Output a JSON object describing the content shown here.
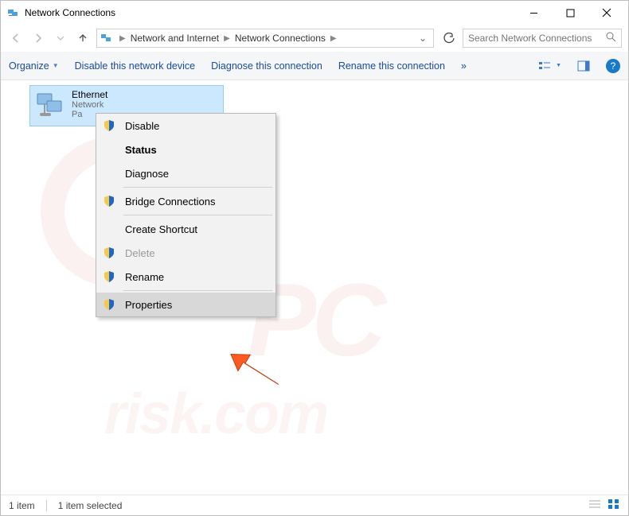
{
  "window": {
    "title": "Network Connections"
  },
  "breadcrumbs": {
    "root": "Network and Internet",
    "current": "Network Connections"
  },
  "search": {
    "placeholder": "Search Network Connections"
  },
  "toolbar": {
    "organize": "Organize",
    "disable": "Disable this network device",
    "diagnose": "Diagnose this connection",
    "rename": "Rename this connection",
    "more": "»"
  },
  "adapter": {
    "name": "Ethernet",
    "network": "Network",
    "driver_prefix": "Pa"
  },
  "context_menu": {
    "disable": "Disable",
    "status": "Status",
    "diagnose": "Diagnose",
    "bridge": "Bridge Connections",
    "shortcut": "Create Shortcut",
    "delete": "Delete",
    "rename": "Rename",
    "properties": "Properties"
  },
  "statusbar": {
    "count": "1 item",
    "selected": "1 item selected"
  },
  "watermark": {
    "big": "PC",
    "site": "risk.com"
  }
}
